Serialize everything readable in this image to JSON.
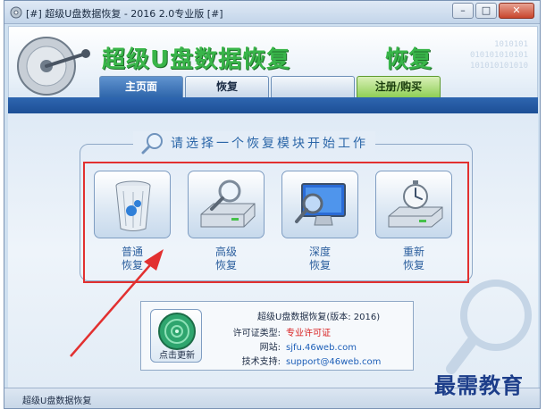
{
  "window": {
    "title": "[#] 超级U盘数据恢复 - 2016 2.0专业版 [#]",
    "buttons": {
      "minimize": "–",
      "maximize": "□",
      "close": "✕"
    }
  },
  "header": {
    "brand": "超级U盘数据恢复",
    "brand_fragment": "恢复",
    "binary_lines": [
      "1010101",
      "010101010101",
      "101010101010"
    ]
  },
  "tabs": [
    {
      "label": "主页面",
      "active": true
    },
    {
      "label": "恢复",
      "active": false
    },
    {
      "label": "",
      "active": false
    },
    {
      "label": "注册/购买",
      "active": false
    }
  ],
  "main": {
    "instruction": "请选择一个恢复模块开始工作",
    "modules": [
      {
        "line1": "普通",
        "line2": "恢复",
        "icon": "recycle-bin-icon"
      },
      {
        "line1": "高级",
        "line2": "恢复",
        "icon": "drive-magnifier-icon"
      },
      {
        "line1": "深度",
        "line2": "恢复",
        "icon": "monitor-magnifier-icon"
      },
      {
        "line1": "重新",
        "line2": "恢复",
        "icon": "drive-stopwatch-icon"
      }
    ]
  },
  "info": {
    "version_text": "超级U盘数据恢复(版本: 2016)",
    "update_label": "点击更新",
    "license_key": "许可证类型:",
    "license_value": "专业许可证",
    "site_key": "网站:",
    "site_value": "sjfu.46web.com",
    "support_key": "技术支持:",
    "support_value": "support@46web.com"
  },
  "status": {
    "text": "超级U盘数据恢复"
  },
  "watermark": "最需教育",
  "colors": {
    "accent_blue": "#2e66b0",
    "brand_green": "#39b54a",
    "highlight_red": "#e23030"
  }
}
